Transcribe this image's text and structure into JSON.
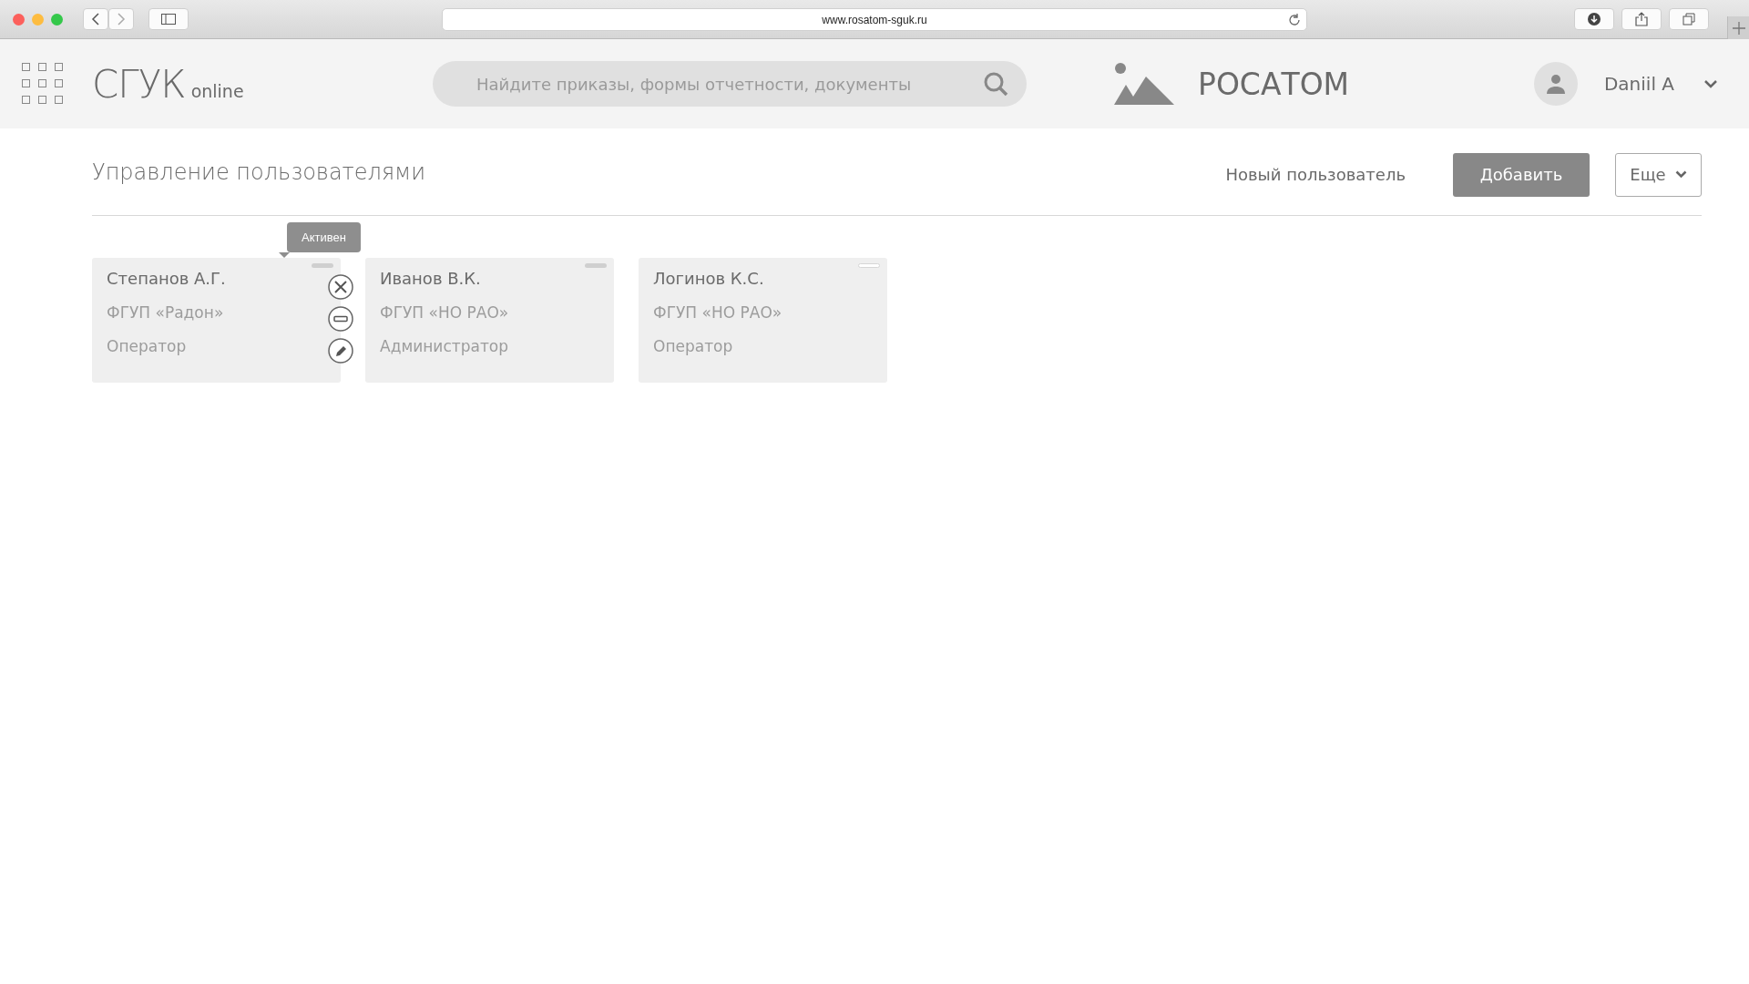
{
  "browser": {
    "url": "www.rosatom-sguk.ru"
  },
  "header": {
    "logo": "СГУК",
    "logo_suffix": "online",
    "search": {
      "placeholder": "Найдите приказы, формы отчетности, документы"
    },
    "brand": "РОСАТОМ",
    "user": "Daniil A"
  },
  "page": {
    "title": "Управление пользователями",
    "new_user_link": "Новый пользователь",
    "add_button": "Добавить",
    "more_button": "Еще"
  },
  "users": [
    {
      "name": "Степанов А.Г.",
      "org": "ФГУП «Радон»",
      "role": "Оператор",
      "active": true,
      "tooltip": "Активен",
      "actions_shown": true
    },
    {
      "name": "Иванов В.К.",
      "org": "ФГУП «НО РАО»",
      "role": "Администратор",
      "active": true,
      "actions_shown": false
    },
    {
      "name": "Логинов К.С.",
      "org": "ФГУП «НО РАО»",
      "role": "Оператор",
      "active": false,
      "actions_shown": false
    }
  ]
}
